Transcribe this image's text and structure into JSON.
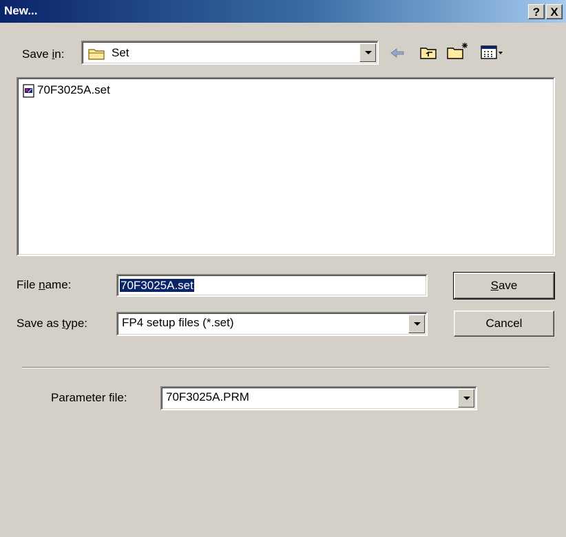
{
  "window": {
    "title": "New...",
    "help_label": "?",
    "close_label": "X"
  },
  "toolbar": {
    "save_in_label_pre": "Save ",
    "save_in_label_key": "i",
    "save_in_label_post": "n:",
    "save_in_value": "Set",
    "icons": [
      "back-icon",
      "up-folder-icon",
      "new-folder-icon",
      "view-menu-icon"
    ]
  },
  "file_list": {
    "items": [
      {
        "name": "70F3025A.set",
        "icon": "setup-file-icon"
      }
    ]
  },
  "file_name": {
    "label_pre": "File ",
    "label_key": "n",
    "label_post": "ame:",
    "value": "70F3025A.set"
  },
  "save_as_type": {
    "label_pre": "Save as ",
    "label_key": "t",
    "label_post": "ype:",
    "value": "FP4 setup files (*.set)"
  },
  "buttons": {
    "save_key": "S",
    "save_rest": "ave",
    "cancel": "Cancel"
  },
  "parameter": {
    "label": "Parameter file:",
    "value": "70F3025A.PRM"
  },
  "colors": {
    "titlebar_start": "#0a246a",
    "titlebar_end": "#a6caf0",
    "dialog_bg": "#d4d0c8",
    "selection": "#0a246a"
  }
}
